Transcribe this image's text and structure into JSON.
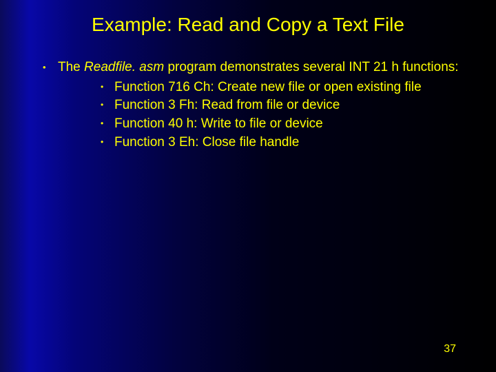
{
  "title": "Example: Read and Copy a Text File",
  "intro_prefix": "The ",
  "intro_italic": "Readfile. asm",
  "intro_suffix": " program demonstrates several INT 21 h functions:",
  "functions": [
    "Function 716 Ch: Create new file or open existing file",
    "Function 3 Fh: Read from file or device",
    "Function 40 h: Write to file or device",
    "Function 3 Eh: Close file handle"
  ],
  "page_number": "37"
}
